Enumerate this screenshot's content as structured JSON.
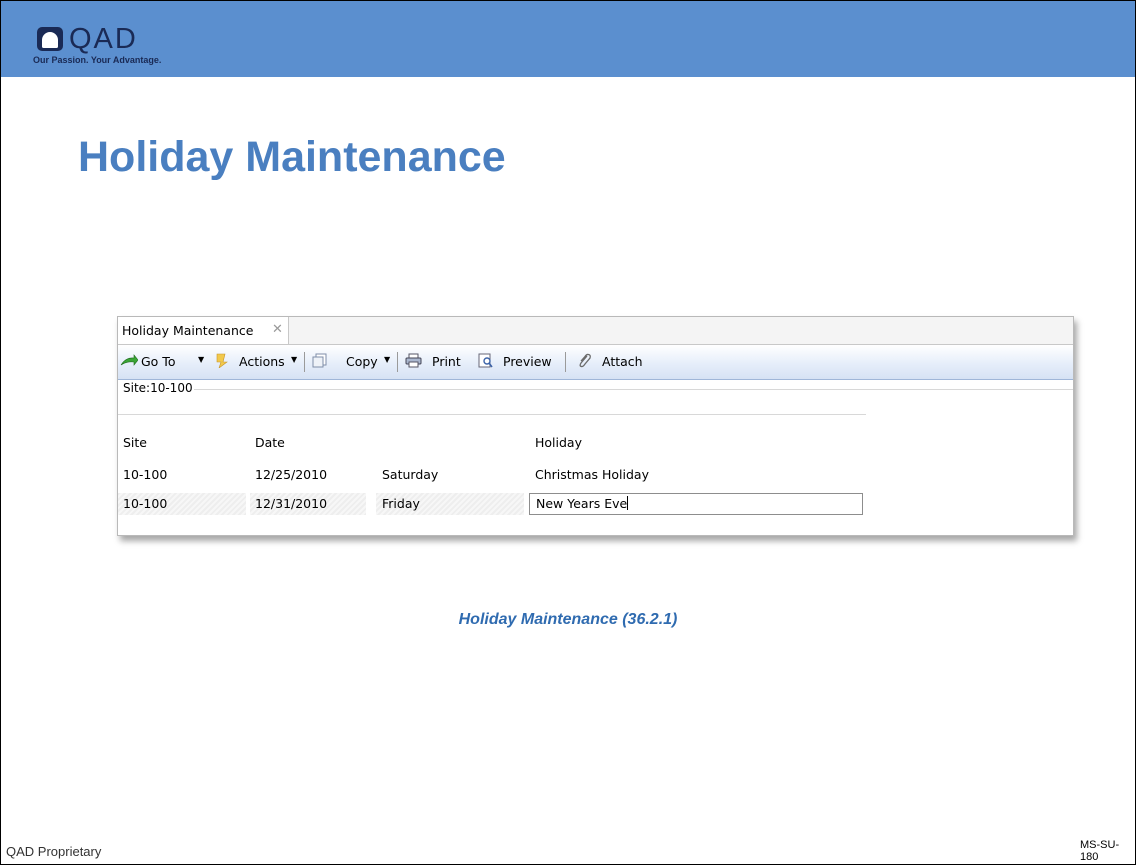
{
  "brand": {
    "logo_word": "QAD",
    "tagline": "Our Passion. Your Advantage.",
    "header_color": "#5b8fcf"
  },
  "slide": {
    "title": "Holiday Maintenance",
    "caption": "Holiday Maintenance (36.2.1)",
    "footer_left": "QAD Proprietary",
    "footer_right": "MS-SU-180",
    "accent_color": "#4a7fc0"
  },
  "app": {
    "tab": {
      "label": "Holiday Maintenance",
      "close_icon": "close-icon"
    },
    "toolbar": {
      "goto_label": "Go To",
      "actions_label": "Actions",
      "copy_label": "Copy",
      "print_label": "Print",
      "preview_label": "Preview",
      "attach_label": "Attach"
    },
    "site_group_label": "Site:10-100",
    "columns": [
      "Site",
      "Date",
      "",
      "Holiday"
    ],
    "rows": [
      {
        "site": "10-100",
        "date": "12/25/2010",
        "day": "Saturday",
        "holiday": "Christmas Holiday"
      },
      {
        "site": "10-100",
        "date": "12/31/2010",
        "day": "Friday",
        "holiday": "New Years Eve"
      }
    ]
  }
}
